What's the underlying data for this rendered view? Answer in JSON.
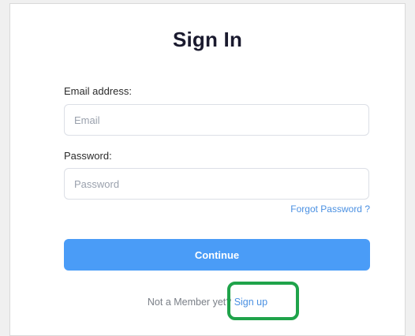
{
  "form": {
    "title": "Sign In",
    "email_label": "Email address:",
    "email_placeholder": "Email",
    "email_value": "",
    "password_label": "Password:",
    "password_placeholder": "Password",
    "password_value": "",
    "forgot_label": "Forgot Password ?",
    "continue_label": "Continue",
    "signup_prompt": "Not a Member yet?",
    "signup_label": "Sign up"
  },
  "colors": {
    "accent": "#4a9cf7",
    "link": "#4a90e2",
    "highlight": "#1fa34a"
  }
}
